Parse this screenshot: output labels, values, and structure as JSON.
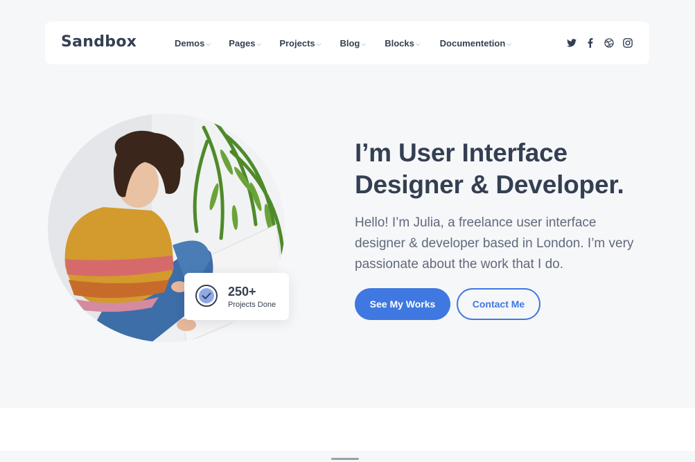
{
  "brand": {
    "name": "Sandbox"
  },
  "nav": {
    "items": [
      {
        "label": "Demos"
      },
      {
        "label": "Pages"
      },
      {
        "label": "Projects"
      },
      {
        "label": "Blog"
      },
      {
        "label": "Blocks"
      },
      {
        "label": "Documentetion"
      }
    ],
    "caret_glyph": "⌵"
  },
  "social": [
    "twitter-icon",
    "facebook-icon",
    "dribbble-icon",
    "instagram-icon"
  ],
  "hero": {
    "headline_line1": "I’m User Interface",
    "headline_line2": "Designer & Developer.",
    "intro": "Hello! I’m Julia, a freelance user interface designer & developer based in London. I’m very passionate about the work that I do.",
    "primary_button": "See My Works",
    "secondary_button": "Contact Me",
    "badge": {
      "value": "250+",
      "label": "Projects Done",
      "icon": "check-icon"
    }
  },
  "colors": {
    "accent": "#3f78e0",
    "text_dark": "#343f52",
    "text_muted": "#60697b",
    "background": "#f6f7f9"
  }
}
